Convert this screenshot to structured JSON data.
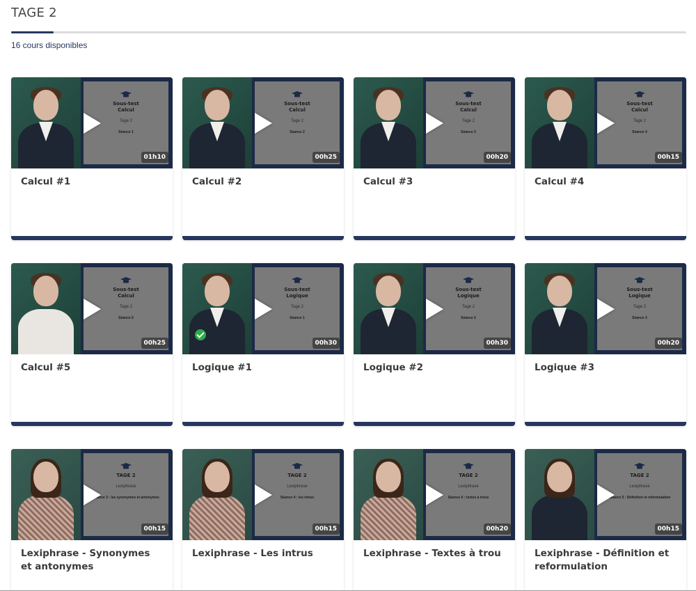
{
  "header": {
    "title": "TAGE 2",
    "course_count": "16 cours disponibles",
    "progress_percent": 6.25
  },
  "colors": {
    "accent": "#26365f",
    "check": "#2eaa4a"
  },
  "cards": [
    {
      "title": "Calcul #1",
      "duration": "01h10",
      "slide_title": "Sous-test\nCalcul",
      "slide_sub": "Tage 2",
      "slide_session": "Séance 1",
      "presenter": "male",
      "completed": false
    },
    {
      "title": "Calcul #2",
      "duration": "00h25",
      "slide_title": "Sous-test\nCalcul",
      "slide_sub": "Tage 2",
      "slide_session": "Séance 2",
      "presenter": "male",
      "completed": false
    },
    {
      "title": "Calcul #3",
      "duration": "00h20",
      "slide_title": "Sous-test\nCalcul",
      "slide_sub": "Tage 2",
      "slide_session": "Séance 3",
      "presenter": "male",
      "completed": false
    },
    {
      "title": "Calcul #4",
      "duration": "00h15",
      "slide_title": "Sous-test\nCalcul",
      "slide_sub": "Tage 2",
      "slide_session": "Séance 4",
      "presenter": "male",
      "completed": false
    },
    {
      "title": "Calcul #5",
      "duration": "00h25",
      "slide_title": "Sous-test\nCalcul",
      "slide_sub": "Tage 2",
      "slide_session": "Séance 5",
      "presenter": "male-white",
      "completed": false
    },
    {
      "title": "Logique #1",
      "duration": "00h30",
      "slide_title": "Sous-test\nLogique",
      "slide_sub": "Tage 2",
      "slide_session": "Séance 1",
      "presenter": "male",
      "completed": true
    },
    {
      "title": "Logique #2",
      "duration": "00h30",
      "slide_title": "Sous-test\nLogique",
      "slide_sub": "Tage 2",
      "slide_session": "Séance 2",
      "presenter": "male",
      "completed": false
    },
    {
      "title": "Logique #3",
      "duration": "00h20",
      "slide_title": "Sous-test\nLogique",
      "slide_sub": "Tage 2",
      "slide_session": "Séance 3",
      "presenter": "male",
      "completed": false
    },
    {
      "title": "Lexiphrase - Synonymes et antonymes",
      "duration": "00h15",
      "slide_title": "TAGE 2",
      "slide_sub": "Lexiphrase",
      "slide_session": "Séance 3 : les synonymes et antonymes",
      "presenter": "female",
      "completed": false
    },
    {
      "title": "Lexiphrase - Les intrus",
      "duration": "00h15",
      "slide_title": "TAGE 2",
      "slide_sub": "Lexiphrase",
      "slide_session": "Séance 4 : les intrus",
      "presenter": "female",
      "completed": false
    },
    {
      "title": "Lexiphrase - Textes à trou",
      "duration": "00h20",
      "slide_title": "TAGE 2",
      "slide_sub": "Lexiphrase",
      "slide_session": "Séance 6 : textes à trous",
      "presenter": "female",
      "completed": false
    },
    {
      "title": "Lexiphrase - Définition et reformulation",
      "duration": "00h15",
      "slide_title": "TAGE 2",
      "slide_sub": "Lexiphrase",
      "slide_session": "Séance 5 : Définition et reformulation",
      "presenter": "female-dark",
      "completed": false
    }
  ],
  "icons": {
    "play": "play-icon",
    "check": "check-icon",
    "cap": "graduation-cap-icon"
  }
}
